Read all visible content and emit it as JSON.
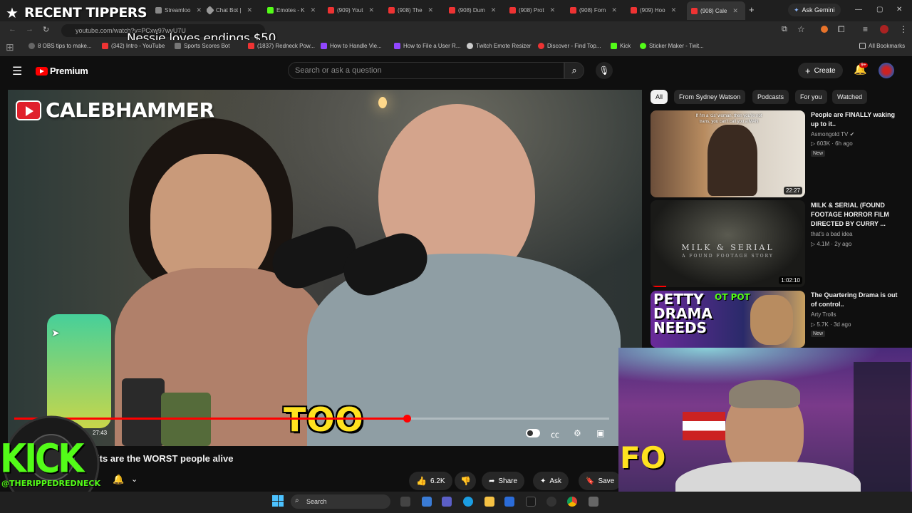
{
  "browser": {
    "overlay_alert_title": "RECENT TIPPERS",
    "tabs": [
      {
        "label": "Streamloo"
      },
      {
        "label": "Chat Bot |"
      },
      {
        "label": "Emotes - K"
      },
      {
        "label": "(909) Yout"
      },
      {
        "label": "(908) The"
      },
      {
        "label": "(908) Dum"
      },
      {
        "label": "(908) Prot"
      },
      {
        "label": "(908) Forn"
      },
      {
        "label": "(909) Hoo"
      },
      {
        "label": "(908) Cale"
      }
    ],
    "new_tab": "+",
    "ask_gemini": "Ask Gemini",
    "url": "youtube.com/watch?v=PCxw97wvU7U",
    "overlay_message": "Nessie loves endings $50",
    "bookmarks": [
      {
        "label": "8 OBS tips to make..."
      },
      {
        "label": "(342) Intro - YouTube"
      },
      {
        "label": "Sports Scores Bot"
      },
      {
        "label": "(1837) Redneck Pow..."
      },
      {
        "label": "How to Handle Vie..."
      },
      {
        "label": "How to File a User R..."
      },
      {
        "label": "Twitch Emote Resizer"
      },
      {
        "label": "Discover - Find Top..."
      },
      {
        "label": "Kick"
      },
      {
        "label": "Sticker Maker - Twit..."
      }
    ],
    "all_bookmarks": "All Bookmarks"
  },
  "youtube": {
    "logo_text": "Premium",
    "search_placeholder": "Search or ask a question",
    "create_label": "Create",
    "notification_count": "9+",
    "video": {
      "watermark": "CALEBHAMMER",
      "caption": "TOO",
      "time": "27:43",
      "progress": 0.66,
      "title_visible": "its are the WORST people alive",
      "likes": "6.2K",
      "share": "Share",
      "ask": "Ask",
      "save": "Save"
    },
    "chips": [
      "All",
      "From Sydney Watson",
      "Podcasts",
      "For you",
      "Watched"
    ],
    "recommendations": [
      {
        "title": "People are FINALLY waking up to it..",
        "channel": "Asmongold TV",
        "views": "603K",
        "age": "6h ago",
        "badge": "New",
        "duration": "22:27",
        "thumb_text": "If I'm a 'cis' woman, then you're not trans, you can't call you a MAN"
      },
      {
        "title": "MILK & SERIAL (FOUND FOOTAGE HORROR FILM DIRECTED BY CURRY ...",
        "channel": "that's a bad idea",
        "views": "4.1M",
        "age": "2y ago",
        "badge": "",
        "duration": "1:02:10",
        "thumb_text": "MILK & SERIAL",
        "thumb_sub": "A FOUND FOOTAGE STORY"
      },
      {
        "title": "The Quartering Drama is out of control..",
        "channel": "Arty Trolls",
        "views": "5.7K",
        "age": "3d ago",
        "badge": "New",
        "duration": "",
        "thumb_text": "PETTY DRAMA NEEDS",
        "thumb_tag": "OT POT"
      }
    ]
  },
  "stream_overlay": {
    "kick_logo": "KICK",
    "handle": "@THERIPPEDREDNECK",
    "webcam_text": "FO"
  },
  "taskbar": {
    "search": "Search"
  },
  "colors": {
    "youtube_red": "#ff0000",
    "kick_green": "#53fc18",
    "caption_yellow": "#ffe21f"
  }
}
